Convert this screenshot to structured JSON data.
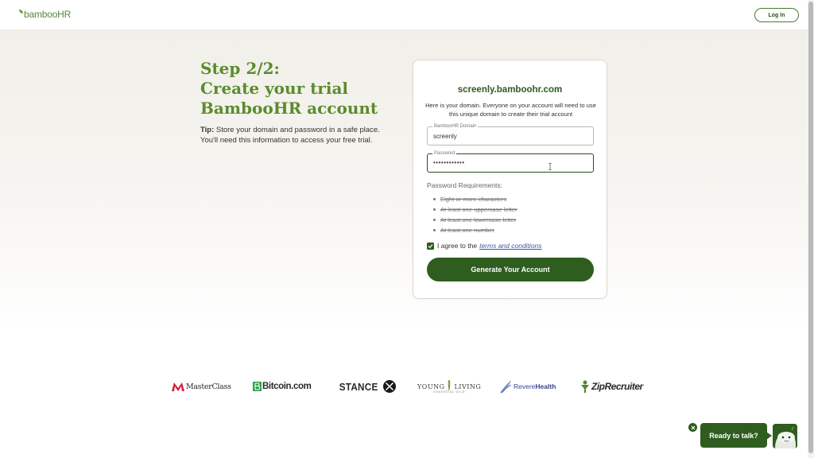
{
  "header": {
    "logo_text": "bamboo",
    "logo_text_bold": "HR",
    "login_label": "Log In"
  },
  "left": {
    "step_line1": "Step 2/2:",
    "step_line2": "Create your trial",
    "step_line3": "BambooHR account",
    "tip_label": "Tip:",
    "tip_text": " Store your domain and password in a safe place. You'll need this information to access your free trial."
  },
  "card": {
    "domain_title": "screenly.bamboohr.com",
    "domain_desc": "Here is your domain. Everyone on your account will need to use this unique domain to create their trial account",
    "domain_field": {
      "label": "BambooHR Domain",
      "value": "screenly"
    },
    "password_field": {
      "label": "Password",
      "value": "••••••••••••"
    },
    "req_title": "Password Requirements:",
    "requirements": [
      "Eight or more characters",
      "At least one uppercase letter",
      "At least one lowercase letter",
      "At least one number"
    ],
    "agree_text": "I agree to the",
    "agree_link": "terms and conditions",
    "generate_label": "Generate Your Account"
  },
  "logos": {
    "masterclass": "MasterClass",
    "bitcoin": "Bitcoin.com",
    "stance": "STANCE",
    "young": "YOUNG",
    "living": "LIVING",
    "living_sub": "ESSENTIAL OILS",
    "revere": "Revere",
    "revere_bold": "Health",
    "zip": "ZipRecruiter"
  },
  "chat": {
    "label": "Ready to talk?"
  },
  "colors": {
    "brand_green": "#5a8c2c",
    "dark_green": "#2e5d1f",
    "link_blue": "#3b5ba5"
  }
}
